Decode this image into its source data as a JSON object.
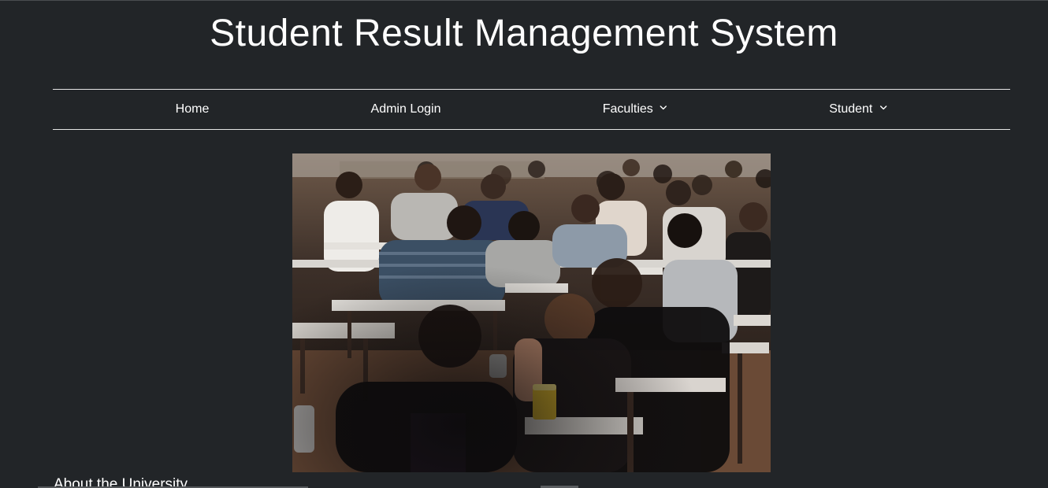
{
  "header": {
    "title": "Student Result Management System"
  },
  "nav": {
    "items": [
      {
        "label": "Home",
        "dropdown": false
      },
      {
        "label": "Admin Login",
        "dropdown": false
      },
      {
        "label": "Faculties",
        "dropdown": true
      },
      {
        "label": "Student",
        "dropdown": true
      }
    ]
  },
  "hero": {
    "image": "students-taking-exam-photo"
  },
  "about": {
    "heading": "About the University"
  },
  "colors": {
    "background": "#222528",
    "text": "#ffffff",
    "nav_border": "#e6e6e6"
  }
}
